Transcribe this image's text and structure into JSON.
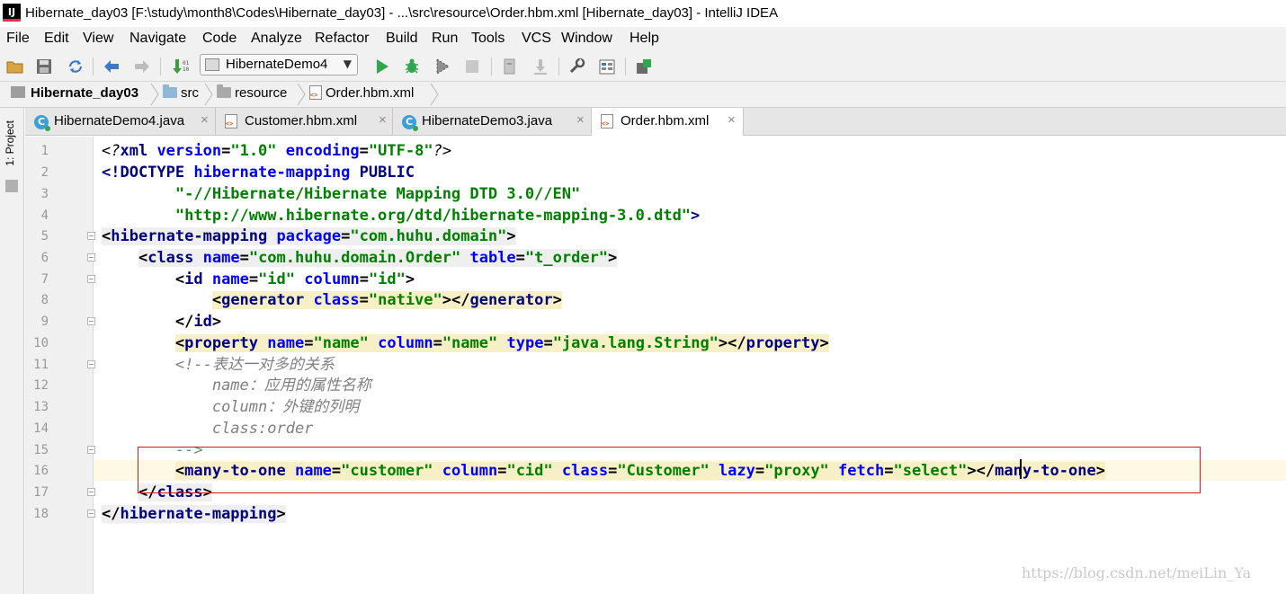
{
  "window": {
    "title": "Hibernate_day03 [F:\\study\\month8\\Codes\\Hibernate_day03] - ...\\src\\resource\\Order.hbm.xml [Hibernate_day03] - IntelliJ IDEA",
    "app_icon_text": "IJ"
  },
  "menu": [
    "File",
    "Edit",
    "View",
    "Navigate",
    "Code",
    "Analyze",
    "Refactor",
    "Build",
    "Run",
    "Tools",
    "VCS",
    "Window",
    "Help"
  ],
  "toolbar": {
    "run_config": "HibernateDemo4",
    "icons": [
      "open-folder-icon",
      "save-icon",
      "sync-icon",
      "back-icon",
      "forward-icon",
      "make-icon",
      "run-icon",
      "debug-icon",
      "coverage-icon",
      "stop-icon",
      "attach-icon",
      "download-icon",
      "settings-icon",
      "project-structure-icon",
      "sdk-icon"
    ]
  },
  "breadcrumb": [
    "Hibernate_day03",
    "src",
    "resource",
    "Order.hbm.xml"
  ],
  "left_stripe": {
    "project_label": "1: Project"
  },
  "tabs": [
    {
      "label": "HibernateDemo4.java",
      "type": "class",
      "active": false
    },
    {
      "label": "Customer.hbm.xml",
      "type": "xml",
      "active": false
    },
    {
      "label": "HibernateDemo3.java",
      "type": "class",
      "active": false
    },
    {
      "label": "Order.hbm.xml",
      "type": "xml",
      "active": true
    }
  ],
  "tab_close_glyph": "×",
  "editor": {
    "line_numbers": [
      "1",
      "2",
      "3",
      "4",
      "5",
      "6",
      "7",
      "8",
      "9",
      "10",
      "11",
      "12",
      "13",
      "14",
      "15",
      "16",
      "17",
      "18"
    ],
    "code": {
      "l1": [
        "<?",
        "xml ",
        "version",
        "=",
        "\"1.0\"",
        " ",
        "encoding",
        "=",
        "\"UTF-8\"",
        "?>"
      ],
      "l2": [
        "<!DOCTYPE ",
        "hibernate-mapping ",
        "PUBLIC"
      ],
      "l3": [
        "        ",
        "\"-//Hibernate/Hibernate Mapping DTD 3.0//EN\""
      ],
      "l4": [
        "        ",
        "\"http://www.hibernate.org/dtd/hibernate-mapping-3.0.dtd\"",
        ">"
      ],
      "l5": [
        "<",
        "hibernate-mapping ",
        "package",
        "=",
        "\"com.huhu.domain\"",
        ">"
      ],
      "l6": [
        "    ",
        "<",
        "class ",
        "name",
        "=",
        "\"com.huhu.domain.Order\"",
        " ",
        "table",
        "=",
        "\"t_order\"",
        ">"
      ],
      "l7": [
        "        ",
        "<",
        "id ",
        "name",
        "=",
        "\"id\"",
        " ",
        "column",
        "=",
        "\"id\"",
        ">"
      ],
      "l8": [
        "            ",
        "<",
        "generator ",
        "class",
        "=",
        "\"native\"",
        "></",
        "generator",
        ">"
      ],
      "l9": [
        "        ",
        "</",
        "id",
        ">"
      ],
      "l10": [
        "        ",
        "<",
        "property ",
        "name",
        "=",
        "\"name\"",
        " ",
        "column",
        "=",
        "\"name\"",
        " ",
        "type",
        "=",
        "\"java.lang.String\"",
        "></",
        "property",
        ">"
      ],
      "l11": [
        "        ",
        "<!--表达一对多的关系"
      ],
      "l12": [
        "            ",
        "name：应用的属性名称"
      ],
      "l13": [
        "            ",
        "column：外键的列明"
      ],
      "l14": [
        "            ",
        "class:order"
      ],
      "l15": [
        "        ",
        "-->"
      ],
      "l16": [
        "        ",
        "<",
        "many-to-one ",
        "name",
        "=",
        "\"customer\"",
        " ",
        "column",
        "=",
        "\"cid\"",
        " ",
        "class",
        "=",
        "\"Customer\"",
        " ",
        "lazy",
        "=",
        "\"proxy\"",
        " ",
        "fetch",
        "=",
        "\"select",
        "\"",
        "></",
        "many-to-one",
        ">"
      ],
      "l17": [
        "    ",
        "</",
        "class",
        ">"
      ],
      "l18": [
        "</",
        "hibernate-mapping",
        ">"
      ]
    }
  },
  "watermark": "https://blog.csdn.net/meiLin_Ya"
}
